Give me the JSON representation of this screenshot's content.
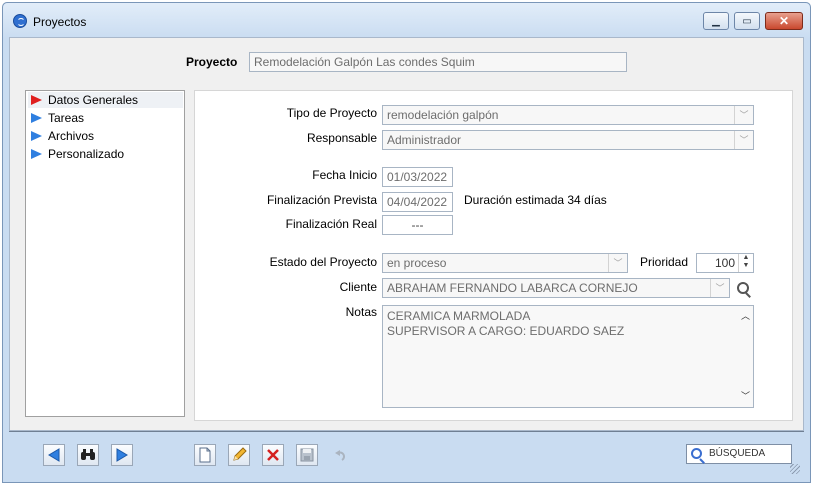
{
  "window": {
    "title": "Proyectos"
  },
  "header": {
    "project_label": "Proyecto",
    "project_name": "Remodelación Galpón Las condes Squim"
  },
  "sidebar": {
    "items": [
      {
        "label": "Datos Generales",
        "selected": true,
        "arrow_color": "#e02020"
      },
      {
        "label": "Tareas",
        "arrow_color": "#2f7fe0"
      },
      {
        "label": "Archivos",
        "arrow_color": "#2f7fe0"
      },
      {
        "label": "Personalizado",
        "arrow_color": "#2f7fe0"
      }
    ]
  },
  "form": {
    "tipo_label": "Tipo de Proyecto",
    "tipo_value": "remodelación galpón",
    "responsable_label": "Responsable",
    "responsable_value": "Administrador",
    "fecha_inicio_label": "Fecha Inicio",
    "fecha_inicio_value": "01/03/2022",
    "fin_prevista_label": "Finalización Prevista",
    "fin_prevista_value": "04/04/2022",
    "duracion_text": "Duración estimada 34 días",
    "fin_real_label": "Finalización Real",
    "fin_real_value": "---",
    "estado_label": "Estado del Proyecto",
    "estado_value": "en proceso",
    "prioridad_label": "Prioridad",
    "prioridad_value": "100",
    "cliente_label": "Cliente",
    "cliente_value": "ABRAHAM FERNANDO LABARCA CORNEJO",
    "notas_label": "Notas",
    "notas_lines": [
      "CERAMICA MARMOLADA",
      "SUPERVISOR A CARGO: EDUARDO SAEZ"
    ]
  },
  "toolbar": {
    "search_label": "BÚSQUEDA"
  },
  "colors": {
    "frame": "#c9dcf1",
    "accent_blue": "#2f7fe0",
    "accent_red": "#e02020"
  }
}
